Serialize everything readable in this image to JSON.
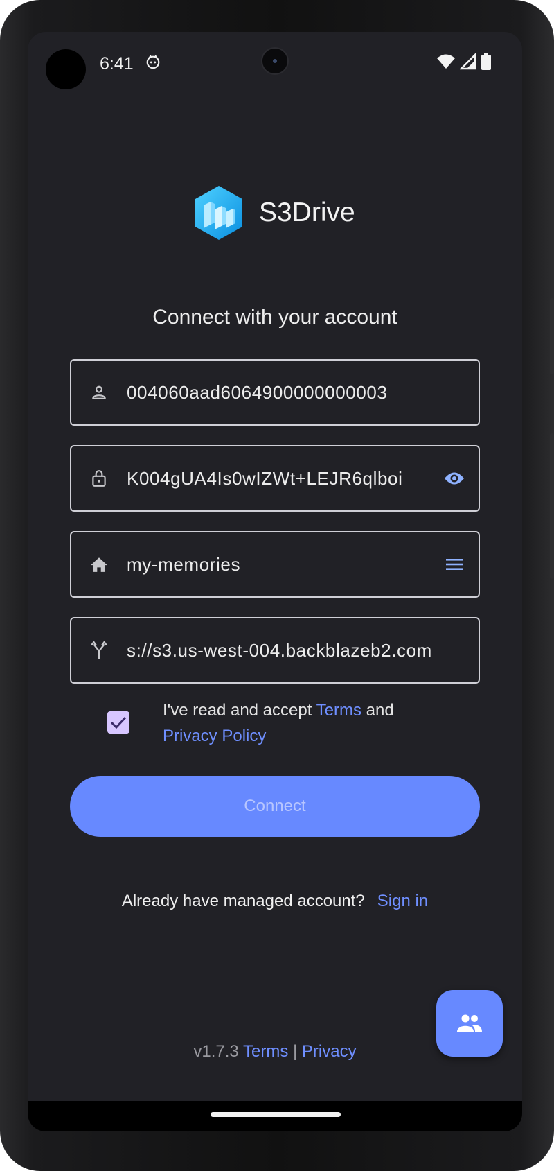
{
  "status_bar": {
    "time": "6:41",
    "icons": [
      "app-notification-icon",
      "wifi-icon",
      "signal-icon",
      "battery-icon"
    ]
  },
  "app": {
    "name": "S3Drive"
  },
  "form": {
    "heading": "Connect with your account",
    "access_key": {
      "value": "004060aad6064900000000003",
      "icon": "person-icon"
    },
    "secret_key": {
      "value": "K004gUA4Is0wIZWt+LEJR6qlboi",
      "icon": "lock-icon",
      "trailing_icon": "eye-icon"
    },
    "bucket": {
      "value": "my-memories",
      "icon": "home-icon",
      "trailing_icon": "menu-icon"
    },
    "endpoint": {
      "value": "s://s3.us-west-004.backblazeb2.com",
      "icon": "fork-icon"
    },
    "consent": {
      "checked": true,
      "prefix": "I've read and accept ",
      "terms_link": "Terms",
      "middle": " and",
      "privacy_link": "Privacy Policy"
    },
    "connect_label": "Connect"
  },
  "signin": {
    "prompt": "Already have managed account?",
    "link": "Sign in"
  },
  "footer": {
    "version": "v1.7.3",
    "terms": "Terms",
    "separator": "|",
    "privacy": "Privacy"
  },
  "colors": {
    "background": "#212126",
    "accent": "#6789ff",
    "link": "#6f8fff",
    "checkbox": "#d7c6ff"
  }
}
